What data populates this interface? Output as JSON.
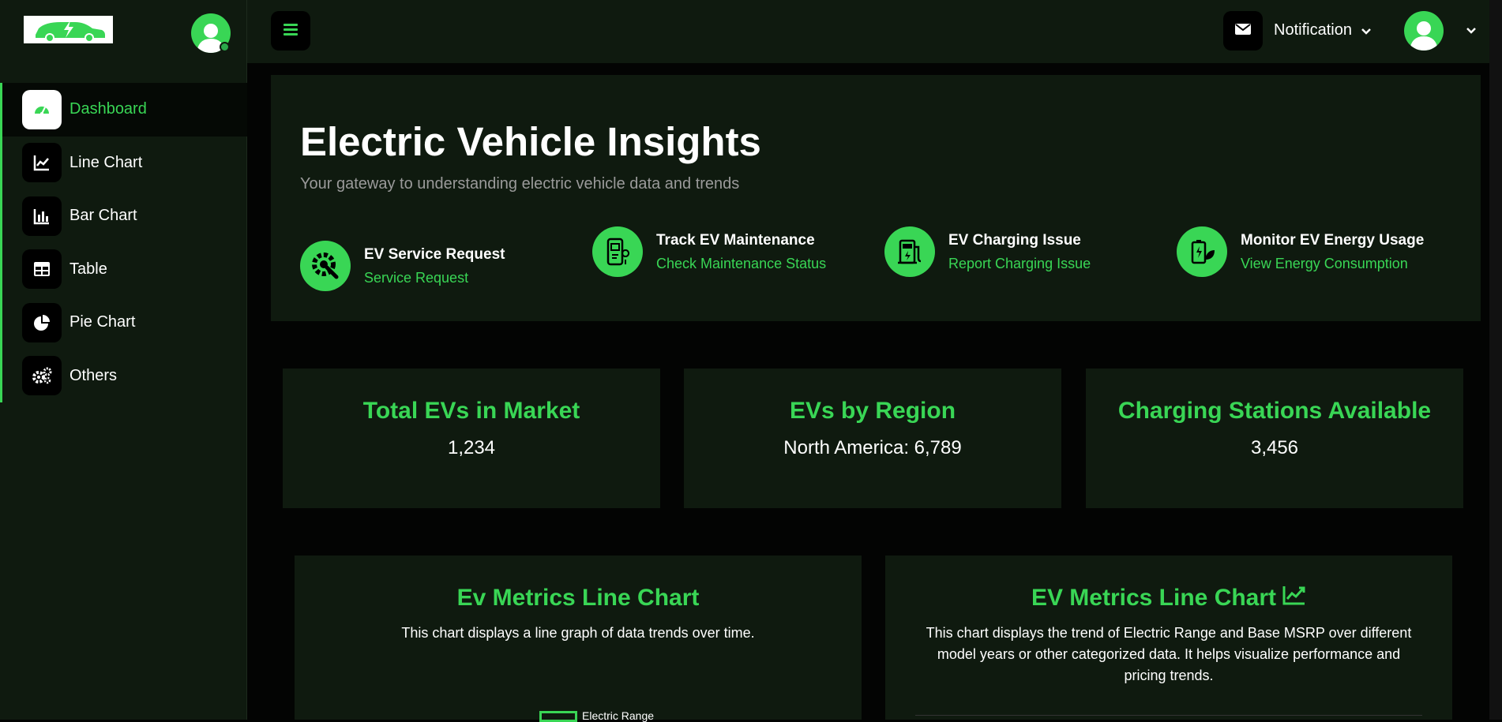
{
  "sidebar": {
    "items": [
      {
        "label": "Dashboard",
        "icon": "speedometer-icon",
        "active": true
      },
      {
        "label": "Line Chart",
        "icon": "line-chart-icon"
      },
      {
        "label": "Bar Chart",
        "icon": "bar-chart-icon"
      },
      {
        "label": "Table",
        "icon": "table-icon"
      },
      {
        "label": "Pie Chart",
        "icon": "pie-chart-icon"
      },
      {
        "label": "Others",
        "icon": "cogs-icon"
      }
    ]
  },
  "topbar": {
    "notification_label": "Notification"
  },
  "hero": {
    "title": "Electric Vehicle Insights",
    "subtitle": "Your gateway to understanding electric vehicle data and trends",
    "actions": [
      {
        "title": "EV Service Request",
        "link": "Service Request",
        "icon": "wrench-gear-icon"
      },
      {
        "title": "Track EV Maintenance",
        "link": "Check Maintenance Status",
        "icon": "maintenance-phone-icon"
      },
      {
        "title": "EV Charging Issue",
        "link": "Report Charging Issue",
        "icon": "charging-station-icon"
      },
      {
        "title": "Monitor EV Energy Usage",
        "link": "View Energy Consumption",
        "icon": "battery-leaf-icon"
      }
    ]
  },
  "stats": [
    {
      "title": "Total EVs in Market",
      "value": "1,234"
    },
    {
      "title": "EVs by Region",
      "value": "North America: 6,789"
    },
    {
      "title": "Charging Stations Available",
      "value": "3,456"
    }
  ],
  "cards": [
    {
      "title": "Ev Metrics Line Chart",
      "desc": "This chart displays a line graph of data trends over time.",
      "legend": "Electric Range"
    },
    {
      "title": "EV Metrics Line Chart",
      "desc": "This chart displays the trend of Electric Range and Base MSRP over different model years or other categorized data. It helps visualize performance and pricing trends."
    }
  ],
  "colors": {
    "accent": "#39d655",
    "panel": "#0f1a0f",
    "background": "#030403"
  }
}
